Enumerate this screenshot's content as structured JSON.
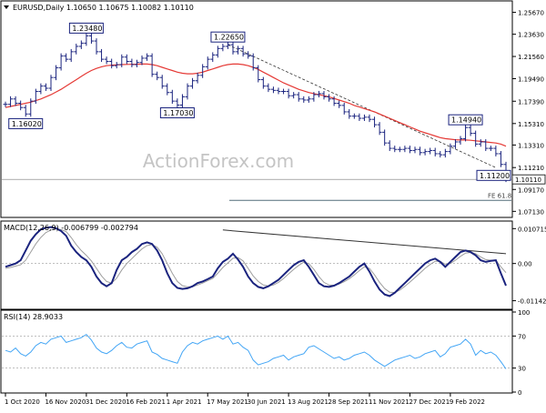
{
  "chart_data": {
    "type": "line",
    "price_panel": {
      "header": "EURUSD,Daily  1.10650 1.10675 1.10082 1.10110",
      "watermark": "ActionForex.com",
      "y_ticks": [
        1.2567,
        1.2363,
        1.2156,
        1.1949,
        1.1739,
        1.1531,
        1.1331,
        1.1121,
        1.0917,
        1.0713
      ],
      "y_tick_labels": [
        "1.25670",
        "1.23630",
        "1.21560",
        "1.19490",
        "1.17390",
        "1.15310",
        "1.13310",
        "1.11210",
        "1.09170",
        "1.07130"
      ],
      "ylim": [
        1.0665,
        1.2665
      ],
      "current_value": 1.1011,
      "current_label": "1.10110",
      "fe_label": "FE 61.8",
      "fe_level": 1.0815,
      "close": [
        1.171,
        1.176,
        1.172,
        1.168,
        1.162,
        1.174,
        1.183,
        1.188,
        1.186,
        1.196,
        1.205,
        1.216,
        1.213,
        1.22,
        1.225,
        1.228,
        1.2348,
        1.23,
        1.22,
        1.213,
        1.211,
        1.207,
        1.208,
        1.215,
        1.211,
        1.208,
        1.21,
        1.214,
        1.216,
        1.199,
        1.196,
        1.188,
        1.182,
        1.174,
        1.1703,
        1.178,
        1.188,
        1.193,
        1.198,
        1.206,
        1.213,
        1.217,
        1.223,
        1.225,
        1.2265,
        1.22,
        1.223,
        1.218,
        1.216,
        1.205,
        1.194,
        1.188,
        1.185,
        1.184,
        1.183,
        1.183,
        1.179,
        1.18,
        1.176,
        1.175,
        1.176,
        1.18,
        1.181,
        1.178,
        1.176,
        1.172,
        1.17,
        1.164,
        1.16,
        1.16,
        1.158,
        1.159,
        1.157,
        1.152,
        1.145,
        1.135,
        1.13,
        1.129,
        1.129,
        1.13,
        1.128,
        1.129,
        1.126,
        1.127,
        1.128,
        1.125,
        1.124,
        1.127,
        1.132,
        1.136,
        1.139,
        1.1494,
        1.144,
        1.134,
        1.136,
        1.13,
        1.13,
        1.125,
        1.115,
        1.1011
      ],
      "ma": [
        1.168,
        1.169,
        1.17,
        1.171,
        1.172,
        1.173,
        1.1745,
        1.176,
        1.178,
        1.18,
        1.1825,
        1.185,
        1.188,
        1.191,
        1.194,
        1.197,
        1.2,
        1.2025,
        1.2045,
        1.206,
        1.207,
        1.2075,
        1.2078,
        1.208,
        1.2082,
        1.2083,
        1.2084,
        1.2085,
        1.2085,
        1.208,
        1.207,
        1.2055,
        1.204,
        1.2025,
        1.201,
        1.2,
        1.1995,
        1.1995,
        1.2,
        1.201,
        1.2025,
        1.204,
        1.2055,
        1.207,
        1.208,
        1.2085,
        1.2085,
        1.208,
        1.207,
        1.2055,
        1.2035,
        1.201,
        1.1985,
        1.196,
        1.1935,
        1.191,
        1.189,
        1.187,
        1.185,
        1.1835,
        1.182,
        1.181,
        1.18,
        1.179,
        1.178,
        1.1765,
        1.175,
        1.1735,
        1.172,
        1.17,
        1.1685,
        1.167,
        1.1655,
        1.164,
        1.162,
        1.16,
        1.158,
        1.156,
        1.154,
        1.152,
        1.15,
        1.148,
        1.146,
        1.1445,
        1.143,
        1.1415,
        1.14,
        1.139,
        1.1385,
        1.138,
        1.1378,
        1.1378,
        1.1375,
        1.137,
        1.1365,
        1.136,
        1.1355,
        1.135,
        1.134,
        1.132
      ],
      "labels": [
        {
          "text": "1.16020",
          "i": 4,
          "value": 1.1602,
          "place": "below"
        },
        {
          "text": "1.23480",
          "i": 16,
          "value": 1.2348,
          "place": "above"
        },
        {
          "text": "1.17030",
          "i": 34,
          "value": 1.1703,
          "place": "below"
        },
        {
          "text": "1.22650",
          "i": 44,
          "value": 1.2265,
          "place": "above"
        },
        {
          "text": "1.14940",
          "i": 91,
          "value": 1.1494,
          "place": "above"
        },
        {
          "text": "1.11200",
          "i": 97,
          "value": 1.112,
          "place": "below"
        }
      ],
      "trendline": {
        "from_i": 44,
        "from_value": 1.2265,
        "to_i": 97,
        "to_value": 1.112
      }
    },
    "macd_panel": {
      "header": "MACD(12,26,9) -0.006799 -0.002794",
      "y_ticks": [
        0.010715,
        0.0,
        -0.011424
      ],
      "y_tick_labels": [
        "0.010715",
        "0.00",
        "-0.011424"
      ],
      "ylim": [
        -0.0135,
        0.0122
      ],
      "macd": [
        -0.001,
        -0.0005,
        0.0,
        0.001,
        0.004,
        0.007,
        0.009,
        0.0105,
        0.011,
        0.0112,
        0.0108,
        0.01,
        0.0085,
        0.0055,
        0.0035,
        0.002,
        0.001,
        -0.001,
        -0.004,
        -0.006,
        -0.007,
        -0.006,
        -0.002,
        0.001,
        0.002,
        0.0035,
        0.0045,
        0.006,
        0.0065,
        0.006,
        0.004,
        0.001,
        -0.003,
        -0.006,
        -0.0075,
        -0.0078,
        -0.0076,
        -0.007,
        -0.006,
        -0.0055,
        -0.0048,
        -0.004,
        -0.0015,
        0.0005,
        0.0015,
        0.003,
        0.0012,
        -0.001,
        -0.004,
        -0.006,
        -0.0072,
        -0.0076,
        -0.007,
        -0.006,
        -0.005,
        -0.0035,
        -0.002,
        -0.0005,
        0.0005,
        0.001,
        -0.001,
        -0.0035,
        -0.006,
        -0.007,
        -0.0072,
        -0.0068,
        -0.006,
        -0.005,
        -0.004,
        -0.0025,
        -0.001,
        0.0,
        -0.0025,
        -0.0055,
        -0.008,
        -0.0095,
        -0.01,
        -0.009,
        -0.0075,
        -0.006,
        -0.0045,
        -0.003,
        -0.0015,
        0.0,
        0.001,
        0.0015,
        0.0005,
        -0.001,
        0.0005,
        0.002,
        0.0035,
        0.004,
        0.0035,
        0.0025,
        0.001,
        0.0005,
        0.0008,
        0.001,
        -0.003,
        -0.0068
      ],
      "signal": [
        -0.0015,
        -0.0012,
        -0.0008,
        -0.0004,
        0.001,
        0.0035,
        0.006,
        0.008,
        0.0095,
        0.0103,
        0.0106,
        0.0104,
        0.0098,
        0.008,
        0.0058,
        0.004,
        0.0025,
        0.0008,
        -0.0015,
        -0.0038,
        -0.0055,
        -0.006,
        -0.0045,
        -0.002,
        0.0,
        0.0015,
        0.003,
        0.0045,
        0.0055,
        0.0058,
        0.005,
        0.003,
        0.0,
        -0.003,
        -0.0055,
        -0.0068,
        -0.0072,
        -0.0071,
        -0.0066,
        -0.006,
        -0.0053,
        -0.0046,
        -0.003,
        -0.0012,
        0.0002,
        0.0016,
        0.0018,
        0.0008,
        -0.0015,
        -0.0038,
        -0.0055,
        -0.0066,
        -0.0069,
        -0.0066,
        -0.0058,
        -0.0046,
        -0.0032,
        -0.0018,
        -0.0006,
        0.0004,
        0.0,
        -0.0018,
        -0.004,
        -0.0058,
        -0.0066,
        -0.0067,
        -0.0063,
        -0.0056,
        -0.0047,
        -0.0035,
        -0.0022,
        -0.001,
        -0.0015,
        -0.0035,
        -0.0058,
        -0.0077,
        -0.0088,
        -0.0089,
        -0.0082,
        -0.007,
        -0.0057,
        -0.0043,
        -0.0029,
        -0.0015,
        -0.0003,
        0.0007,
        0.0007,
        -0.0002,
        0.0,
        0.001,
        0.0022,
        0.0032,
        0.0034,
        0.003,
        0.002,
        0.0012,
        0.001,
        0.001,
        -0.001,
        -0.0028
      ],
      "trendline": {
        "from_i": 43,
        "from_value": 0.0103,
        "to_i": 99,
        "to_value": 0.003
      }
    },
    "rsi_panel": {
      "header": "RSI(14) 28.9033",
      "y_ticks": [
        100,
        70,
        30,
        0
      ],
      "y_tick_labels": [
        "100",
        "70",
        "30",
        "0"
      ],
      "ylim": [
        0,
        100
      ],
      "rsi": [
        52,
        50,
        55,
        48,
        45,
        50,
        58,
        62,
        60,
        66,
        68,
        70,
        62,
        64,
        66,
        68,
        72,
        65,
        55,
        50,
        48,
        52,
        58,
        62,
        56,
        55,
        60,
        62,
        64,
        50,
        47,
        42,
        40,
        38,
        36,
        50,
        58,
        62,
        60,
        64,
        66,
        68,
        70,
        66,
        70,
        60,
        62,
        56,
        52,
        40,
        34,
        36,
        38,
        42,
        44,
        46,
        40,
        44,
        46,
        48,
        56,
        58,
        54,
        50,
        46,
        42,
        44,
        40,
        42,
        46,
        48,
        50,
        46,
        40,
        36,
        32,
        36,
        40,
        42,
        44,
        46,
        42,
        44,
        48,
        50,
        52,
        44,
        48,
        56,
        58,
        60,
        66,
        60,
        46,
        52,
        48,
        50,
        46,
        38,
        29
      ]
    },
    "x_ticks": [
      {
        "i": 0,
        "label": "1 Oct 2020"
      },
      {
        "i": 8,
        "label": "16 Nov 2020"
      },
      {
        "i": 16,
        "label": "31 Dec 2020"
      },
      {
        "i": 24,
        "label": "16 Feb 2021"
      },
      {
        "i": 32,
        "label": "1 Apr 2021"
      },
      {
        "i": 40,
        "label": "17 May 2021"
      },
      {
        "i": 48,
        "label": "30 Jun 2021"
      },
      {
        "i": 56,
        "label": "13 Aug 2021"
      },
      {
        "i": 64,
        "label": "28 Sep 2021"
      },
      {
        "i": 72,
        "label": "11 Nov 2021"
      },
      {
        "i": 80,
        "label": "27 Dec 2021"
      },
      {
        "i": 88,
        "label": "9 Feb 2022"
      }
    ],
    "colors": {
      "price": "#1a237e",
      "ma": "#e53935",
      "label_border": "#1a237e",
      "grid": "#d0d0d0",
      "macd": "#1a237e",
      "signal": "#9e9e9e",
      "rsi": "#42a5f5",
      "fe_line": "#546e7a",
      "trendline": "#333333",
      "watermark": "#c4c4c4"
    }
  }
}
